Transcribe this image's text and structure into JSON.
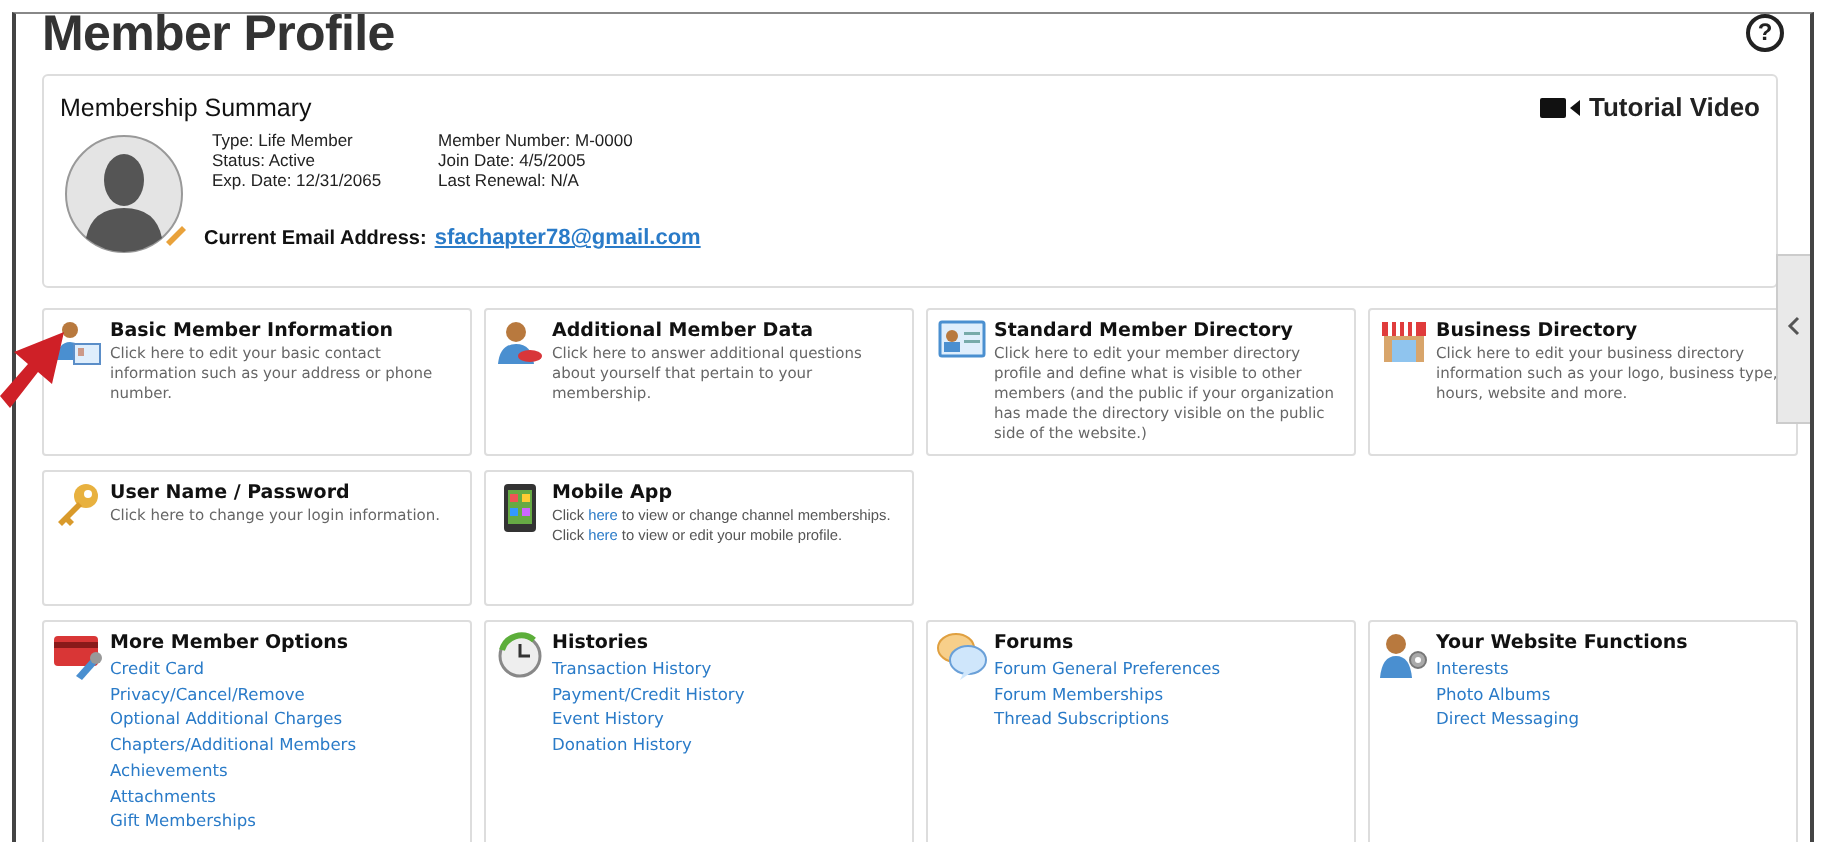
{
  "page": {
    "title": "Member Profile",
    "help": "?"
  },
  "summary": {
    "title": "Membership Summary",
    "video_link": "Tutorial Video",
    "details": [
      [
        "Type: Life Member",
        "Status: Active",
        "Exp. Date: 12/31/2065"
      ],
      [
        "Member Number: M-0000",
        "Join Date: 4/5/2005",
        "Last Renewal: N/A"
      ]
    ],
    "email_label": "Current Email Address:",
    "email": "sfachapter78@gmail.com"
  },
  "rows": [
    [
      {
        "kind": "description",
        "title": "Basic Member Information",
        "description": "Click here to edit your basic contact information such as your address or phone number."
      },
      {
        "kind": "description",
        "title": "Additional Member Data",
        "description": "Click here to answer additional questions about yourself that pertain to your membership."
      },
      {
        "kind": "description",
        "title": "Standard Member Directory",
        "description": "Click here to edit your member directory profile and define what is visible to other members (and the public if your organization has made the directory visible on the public side of the website.)"
      },
      {
        "kind": "description",
        "title": "Business Directory",
        "description": "Click here to edit your business directory information such as your logo, business type, hours, website and more."
      }
    ],
    [
      {
        "kind": "description",
        "title": "User Name / Password",
        "description": "Click here to change your login information."
      },
      {
        "kind": "mobile",
        "title": "Mobile App",
        "lines": [
          {
            "before": "Click",
            "link": "here",
            "after": "to view or change channel memberships."
          },
          {
            "before": "Click",
            "link": "here",
            "after": "to view or edit your mobile profile."
          }
        ]
      }
    ],
    [
      {
        "kind": "links",
        "title": "More Member Options",
        "links": [
          "Credit Card",
          "Privacy/Cancel/Remove",
          "Optional Additional Charges",
          "Chapters/Additional Members",
          "Achievements",
          "Attachments",
          "Gift Memberships"
        ]
      },
      {
        "kind": "links",
        "title": "Histories",
        "links": [
          "Transaction History",
          "Payment/Credit History",
          "Event History",
          "Donation History"
        ]
      },
      {
        "kind": "links",
        "title": "Forums",
        "links": [
          "Forum General Preferences",
          "Forum Memberships",
          "Thread Subscriptions"
        ]
      },
      {
        "kind": "links",
        "title": "Your Website Functions",
        "links": [
          "Interests",
          "Photo Albums",
          "Direct Messaging"
        ]
      }
    ]
  ]
}
